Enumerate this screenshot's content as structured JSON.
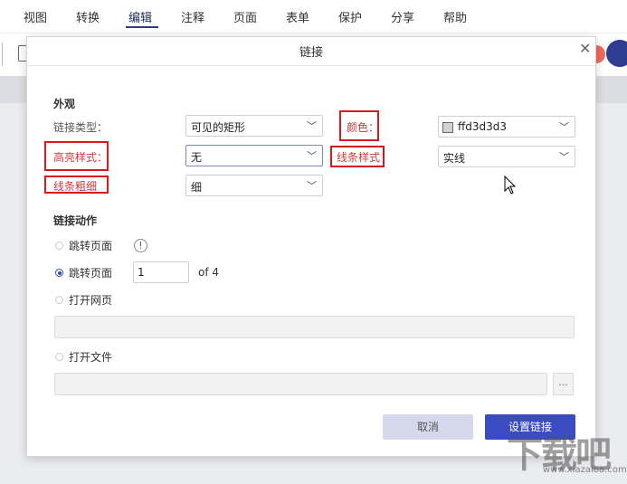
{
  "menu": {
    "items": [
      "视图",
      "转换",
      "编辑",
      "注释",
      "页面",
      "表单",
      "保护",
      "分享",
      "帮助"
    ],
    "active_index": 2
  },
  "dialog": {
    "title": "链接",
    "appearance": {
      "section_title": "外观",
      "link_type_label": "链接类型：",
      "link_type_value": "可见的矩形",
      "color_label": "颜色：",
      "color_value": "ffd3d3d3",
      "highlight_label": "高亮样式：",
      "highlight_value": "无",
      "line_style_label": "线条样式",
      "line_style_value": "实线",
      "line_width_label": "线条粗细",
      "line_width_value": "细"
    },
    "action": {
      "section_title": "链接动作",
      "goto_page_label_1": "跳转页面",
      "goto_page_label_2": "跳转页面",
      "page_number": "1",
      "page_of": "of 4",
      "open_web_label": "打开网页",
      "open_file_label": "打开文件",
      "browse_label": "...",
      "selected_option": "goto_page_2"
    },
    "buttons": {
      "cancel": "取消",
      "confirm": "设置链接"
    }
  },
  "colors": {
    "accent": "#3a4cc0",
    "highlight_box": "#d9171c",
    "swatch": "#d3d3d3"
  },
  "watermark": {
    "text": "下载吧",
    "sub": "www.xiazaiba.com"
  }
}
